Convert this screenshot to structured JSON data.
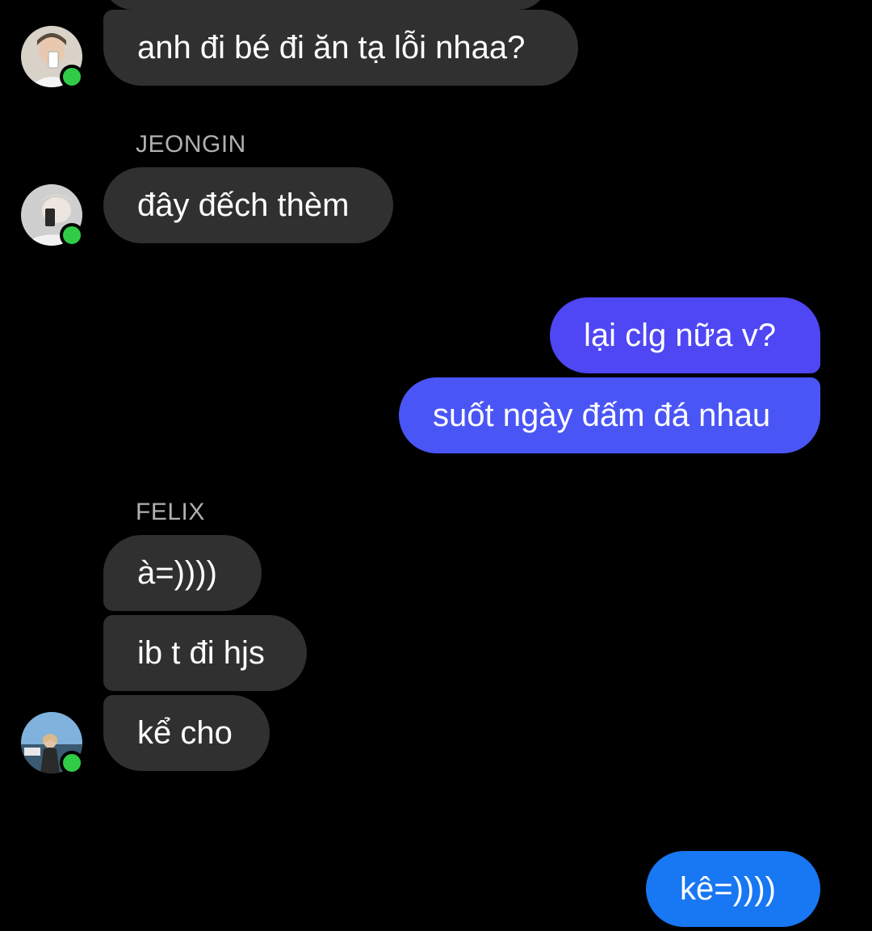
{
  "colors": {
    "background": "#000000",
    "incoming_bubble": "#303030",
    "outgoing_purple": "#4f46f4",
    "outgoing_blue": "#1877f2",
    "sender_name": "#b0b0b0",
    "presence": "#31cc46"
  },
  "conversation": {
    "messages": [
      {
        "direction": "incoming",
        "text": "anh đi bé đi ăn tạ lỗi nhaa?"
      },
      {
        "direction": "incoming",
        "sender": "JEONGIN",
        "text": "đây đếch thèm"
      },
      {
        "direction": "outgoing",
        "text": "lại clg nữa v?"
      },
      {
        "direction": "outgoing",
        "text": "suốt ngày đấm đá nhau"
      },
      {
        "direction": "incoming",
        "sender": "FELIX",
        "text": "à=))))"
      },
      {
        "direction": "incoming",
        "text": "ib t đi hjs"
      },
      {
        "direction": "incoming",
        "text": "kể cho"
      },
      {
        "direction": "outgoing",
        "text": "kê=))))"
      }
    ]
  }
}
